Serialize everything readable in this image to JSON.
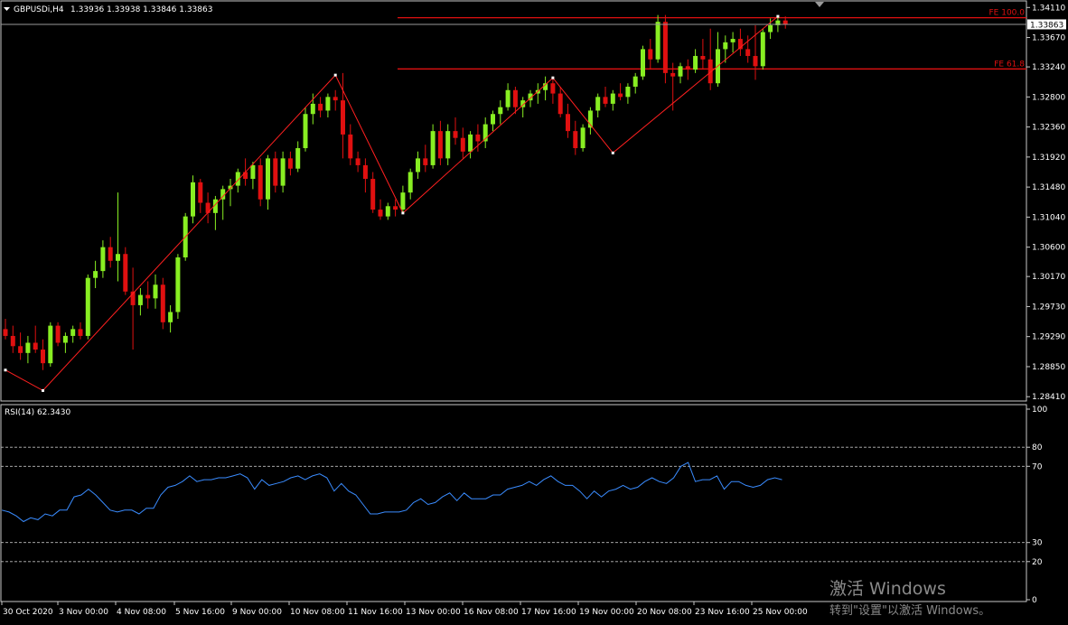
{
  "header": {
    "symbol": "GBPUSDi,H4",
    "ohlc": "1.33936 1.33938 1.33846 1.33863"
  },
  "price_axis": {
    "ticks": [
      "1.34110",
      "1.33670",
      "1.33240",
      "1.32800",
      "1.32360",
      "1.31920",
      "1.31480",
      "1.31040",
      "1.30600",
      "1.30170",
      "1.29730",
      "1.29290",
      "1.28850",
      "1.28410"
    ],
    "current_price": "1.33863"
  },
  "levels": [
    {
      "label": "FE 100.0",
      "price": 1.3396
    },
    {
      "label": "FE 61.8",
      "price": 1.3321
    }
  ],
  "rsi": {
    "title": "RSI(14) 62.3430",
    "ticks": [
      "100",
      "80",
      "70",
      "30",
      "20",
      "0"
    ],
    "levels": [
      80,
      70,
      30,
      20
    ]
  },
  "time_axis": {
    "labels": [
      "30 Oct 2020",
      "3 Nov 00:00",
      "4 Nov 08:00",
      "5 Nov 16:00",
      "9 Nov 00:00",
      "10 Nov 08:00",
      "11 Nov 16:00",
      "13 Nov 00:00",
      "16 Nov 08:00",
      "17 Nov 16:00",
      "19 Nov 00:00",
      "20 Nov 08:00",
      "23 Nov 16:00",
      "25 Nov 00:00"
    ]
  },
  "watermark": {
    "line1": "激活 Windows",
    "line2": "转到\"设置\"以激活 Windows。"
  },
  "colors": {
    "bull": "#88ee22",
    "bear": "#e01010",
    "zigzag": "#ff2020",
    "rsi_line": "#3a8cff",
    "grid": "#ffffff"
  },
  "chart_data": {
    "type": "candlestick",
    "symbol": "GBPUSDi",
    "timeframe": "H4",
    "price_range": [
      1.2836,
      1.3418
    ],
    "candles": [
      [
        1.294,
        1.2955,
        1.2925,
        1.293
      ],
      [
        1.293,
        1.2945,
        1.2905,
        1.2915
      ],
      [
        1.2915,
        1.2935,
        1.2895,
        1.2905
      ],
      [
        1.2905,
        1.293,
        1.289,
        1.292
      ],
      [
        1.292,
        1.2945,
        1.2905,
        1.291
      ],
      [
        1.291,
        1.2925,
        1.288,
        1.289
      ],
      [
        1.289,
        1.295,
        1.2885,
        1.2945
      ],
      [
        1.2945,
        1.295,
        1.2915,
        1.292
      ],
      [
        1.292,
        1.2935,
        1.2905,
        1.293
      ],
      [
        1.293,
        1.2945,
        1.292,
        1.294
      ],
      [
        1.294,
        1.295,
        1.2925,
        1.293
      ],
      [
        1.293,
        1.302,
        1.2925,
        1.3015
      ],
      [
        1.3015,
        1.304,
        1.3,
        1.3025
      ],
      [
        1.3025,
        1.307,
        1.3015,
        1.306
      ],
      [
        1.306,
        1.3075,
        1.303,
        1.304
      ],
      [
        1.304,
        1.314,
        1.301,
        1.305
      ],
      [
        1.305,
        1.306,
        1.299,
        1.2995
      ],
      [
        1.2995,
        1.303,
        1.291,
        1.2975
      ],
      [
        1.2975,
        1.3,
        1.296,
        1.299
      ],
      [
        1.299,
        1.301,
        1.297,
        1.2985
      ],
      [
        1.2985,
        1.302,
        1.297,
        1.3005
      ],
      [
        1.3005,
        1.3015,
        1.294,
        1.295
      ],
      [
        1.295,
        1.2975,
        1.2935,
        1.2965
      ],
      [
        1.2965,
        1.305,
        1.2955,
        1.3045
      ],
      [
        1.3045,
        1.311,
        1.304,
        1.3105
      ],
      [
        1.3105,
        1.3165,
        1.3095,
        1.3155
      ],
      [
        1.3155,
        1.316,
        1.311,
        1.3125
      ],
      [
        1.3125,
        1.314,
        1.3095,
        1.311
      ],
      [
        1.311,
        1.3135,
        1.3085,
        1.313
      ],
      [
        1.313,
        1.315,
        1.31,
        1.3145
      ],
      [
        1.3145,
        1.316,
        1.312,
        1.315
      ],
      [
        1.315,
        1.3175,
        1.314,
        1.317
      ],
      [
        1.317,
        1.319,
        1.315,
        1.316
      ],
      [
        1.316,
        1.3185,
        1.3145,
        1.318
      ],
      [
        1.318,
        1.319,
        1.312,
        1.313
      ],
      [
        1.313,
        1.3195,
        1.3115,
        1.319
      ],
      [
        1.319,
        1.32,
        1.314,
        1.315
      ],
      [
        1.315,
        1.32,
        1.314,
        1.319
      ],
      [
        1.319,
        1.32,
        1.3165,
        1.3175
      ],
      [
        1.3175,
        1.3215,
        1.317,
        1.3205
      ],
      [
        1.3205,
        1.3265,
        1.32,
        1.3255
      ],
      [
        1.3255,
        1.3285,
        1.324,
        1.327
      ],
      [
        1.327,
        1.328,
        1.325,
        1.326
      ],
      [
        1.326,
        1.3285,
        1.325,
        1.328
      ],
      [
        1.328,
        1.329,
        1.326,
        1.3275
      ],
      [
        1.3275,
        1.3315,
        1.319,
        1.3225
      ],
      [
        1.3225,
        1.324,
        1.318,
        1.319
      ],
      [
        1.319,
        1.32,
        1.317,
        1.318
      ],
      [
        1.318,
        1.319,
        1.314,
        1.316
      ],
      [
        1.316,
        1.317,
        1.311,
        1.3115
      ],
      [
        1.3115,
        1.313,
        1.31,
        1.3105
      ],
      [
        1.3105,
        1.3125,
        1.31,
        1.312
      ],
      [
        1.312,
        1.313,
        1.3105,
        1.3115
      ],
      [
        1.3115,
        1.315,
        1.311,
        1.314
      ],
      [
        1.314,
        1.3175,
        1.313,
        1.317
      ],
      [
        1.317,
        1.32,
        1.316,
        1.319
      ],
      [
        1.319,
        1.321,
        1.317,
        1.318
      ],
      [
        1.318,
        1.324,
        1.3175,
        1.323
      ],
      [
        1.323,
        1.3245,
        1.318,
        1.319
      ],
      [
        1.319,
        1.324,
        1.318,
        1.323
      ],
      [
        1.323,
        1.325,
        1.321,
        1.322
      ],
      [
        1.322,
        1.3235,
        1.319,
        1.32
      ],
      [
        1.32,
        1.323,
        1.319,
        1.3225
      ],
      [
        1.3225,
        1.324,
        1.32,
        1.3215
      ],
      [
        1.3215,
        1.325,
        1.3205,
        1.324
      ],
      [
        1.324,
        1.326,
        1.323,
        1.3255
      ],
      [
        1.3255,
        1.3275,
        1.324,
        1.3265
      ],
      [
        1.3265,
        1.33,
        1.326,
        1.329
      ],
      [
        1.329,
        1.3295,
        1.3255,
        1.3265
      ],
      [
        1.3265,
        1.328,
        1.325,
        1.3275
      ],
      [
        1.3275,
        1.329,
        1.3265,
        1.3285
      ],
      [
        1.3285,
        1.33,
        1.327,
        1.329
      ],
      [
        1.329,
        1.331,
        1.3275,
        1.33
      ],
      [
        1.33,
        1.331,
        1.327,
        1.3285
      ],
      [
        1.3285,
        1.3295,
        1.325,
        1.3255
      ],
      [
        1.3255,
        1.327,
        1.322,
        1.323
      ],
      [
        1.323,
        1.3245,
        1.3195,
        1.3205
      ],
      [
        1.3205,
        1.324,
        1.32,
        1.3235
      ],
      [
        1.3235,
        1.3265,
        1.3225,
        1.326
      ],
      [
        1.326,
        1.3285,
        1.325,
        1.328
      ],
      [
        1.328,
        1.3295,
        1.3265,
        1.327
      ],
      [
        1.327,
        1.329,
        1.326,
        1.3285
      ],
      [
        1.3285,
        1.33,
        1.3275,
        1.328
      ],
      [
        1.328,
        1.33,
        1.327,
        1.3295
      ],
      [
        1.3295,
        1.3315,
        1.3285,
        1.331
      ],
      [
        1.331,
        1.3355,
        1.3305,
        1.335
      ],
      [
        1.335,
        1.3365,
        1.332,
        1.3335
      ],
      [
        1.3335,
        1.34,
        1.333,
        1.339
      ],
      [
        1.339,
        1.34,
        1.33,
        1.3315
      ],
      [
        1.3315,
        1.333,
        1.326,
        1.331
      ],
      [
        1.331,
        1.333,
        1.33,
        1.3325
      ],
      [
        1.3325,
        1.3335,
        1.3305,
        1.332
      ],
      [
        1.332,
        1.335,
        1.3315,
        1.334
      ],
      [
        1.334,
        1.3365,
        1.332,
        1.3335
      ],
      [
        1.3335,
        1.338,
        1.329,
        1.33
      ],
      [
        1.33,
        1.3375,
        1.3295,
        1.335
      ],
      [
        1.335,
        1.337,
        1.333,
        1.336
      ],
      [
        1.336,
        1.3375,
        1.3345,
        1.3365
      ],
      [
        1.3365,
        1.338,
        1.334,
        1.335
      ],
      [
        1.335,
        1.337,
        1.333,
        1.334
      ],
      [
        1.334,
        1.3385,
        1.3305,
        1.3325
      ],
      [
        1.3325,
        1.338,
        1.332,
        1.3375
      ],
      [
        1.3375,
        1.3395,
        1.3365,
        1.3385
      ],
      [
        1.3385,
        1.3398,
        1.3375,
        1.3392
      ],
      [
        1.3392,
        1.3398,
        1.338,
        1.3386
      ]
    ],
    "zigzag": [
      {
        "i": 0,
        "price": 1.288
      },
      {
        "i": 5,
        "price": 1.285
      },
      {
        "i": 44,
        "price": 1.3312
      },
      {
        "i": 53,
        "price": 1.311
      },
      {
        "i": 73,
        "price": 1.3308
      },
      {
        "i": 81,
        "price": 1.3198
      },
      {
        "i": 103,
        "price": 1.3398
      }
    ],
    "rsi_values": [
      47,
      46,
      44,
      41,
      43,
      42,
      45,
      44,
      47,
      47,
      54,
      55,
      58,
      55,
      51,
      47,
      46,
      47,
      47,
      45,
      48,
      48,
      55,
      59,
      60,
      62,
      65,
      62,
      63,
      63,
      64,
      64,
      65,
      66,
      64,
      58,
      63,
      60,
      61,
      62,
      64,
      65,
      63,
      65,
      66,
      64,
      57,
      61,
      57,
      55,
      50,
      45,
      45,
      46,
      46,
      46,
      47,
      51,
      53,
      50,
      51,
      54,
      56,
      52,
      56,
      53,
      53,
      53,
      55,
      55,
      58,
      59,
      60,
      62,
      60,
      63,
      65,
      62,
      60,
      60,
      57,
      53,
      57,
      54,
      57,
      58,
      60,
      58,
      59,
      62,
      64,
      62,
      61,
      64,
      70,
      72,
      62,
      63,
      63,
      65,
      58,
      62,
      62,
      60,
      59,
      60,
      63,
      64,
      63
    ]
  }
}
